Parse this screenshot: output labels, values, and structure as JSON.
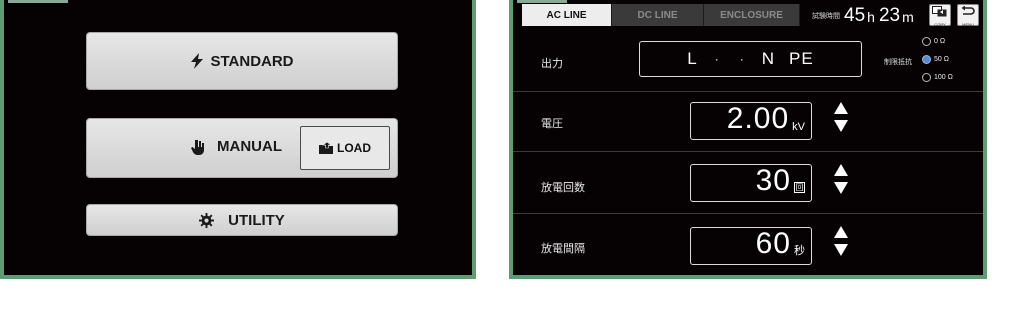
{
  "left": {
    "buttons": {
      "standard": "STANDARD",
      "manual": "MANUAL",
      "load": "LOAD",
      "utility": "UTILITY"
    }
  },
  "right": {
    "tabs": [
      "AC LINE",
      "DC LINE",
      "ENCLOSURE"
    ],
    "active_tab": "AC LINE",
    "timer": {
      "label": "試験時間",
      "hours": "45",
      "hours_unit": "h",
      "minutes": "23",
      "minutes_unit": "m"
    },
    "copy_label": "COPY",
    "menu_label": "MENU",
    "output": {
      "label": "出力",
      "values": [
        "L",
        "·",
        "·",
        "N",
        "PE"
      ]
    },
    "resistor": {
      "label": "制限抵抗",
      "options": [
        "0 Ω",
        "50 Ω",
        "100 Ω"
      ],
      "selected": "50 Ω"
    },
    "voltage": {
      "label": "電圧",
      "value": "2.00",
      "unit": "kV"
    },
    "discharge_count": {
      "label": "放電回数",
      "value": "30",
      "unit": "回"
    },
    "discharge_interval": {
      "label": "放電間隔",
      "value": "60",
      "unit": "秒"
    }
  },
  "colors": {
    "screen_bg": "#060203",
    "bezel": "#5f9c74",
    "button_face": "#dcdcdc",
    "radio_selected": "#5a8ad0"
  }
}
